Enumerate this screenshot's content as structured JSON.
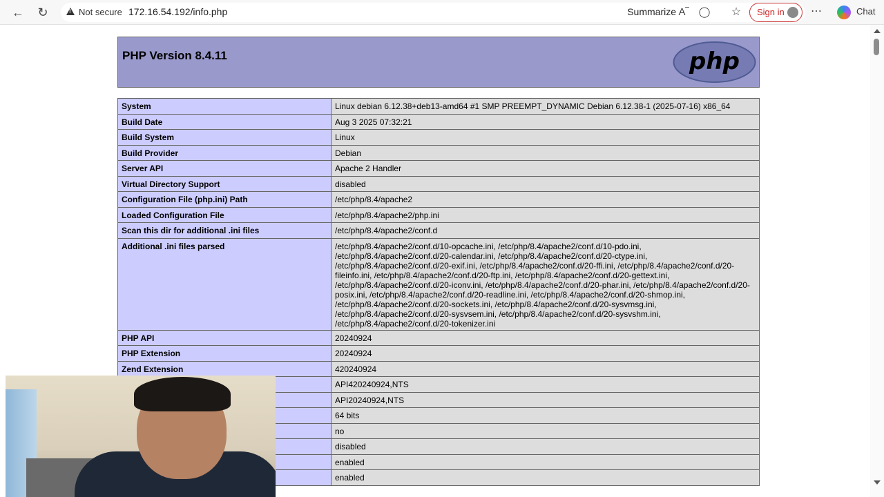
{
  "browser": {
    "not_secure": "Not secure",
    "url": "172.16.54.192/info.php",
    "summarize": "Summarize",
    "sign_in": "Sign in",
    "chat": "Chat",
    "icons": [
      "back-icon",
      "reload-icon",
      "warning-icon",
      "translate-icon",
      "read-aloud-icon",
      "favorite-star-icon",
      "favorites-icon",
      "avatar-icon",
      "more-icon",
      "copilot-icon"
    ]
  },
  "page": {
    "title": "PHP Version 8.4.11",
    "logo_text": "php",
    "rows": [
      {
        "k": "System",
        "v": "Linux debian 6.12.38+deb13-amd64 #1 SMP PREEMPT_DYNAMIC Debian 6.12.38-1 (2025-07-16) x86_64"
      },
      {
        "k": "Build Date",
        "v": "Aug 3 2025 07:32:21"
      },
      {
        "k": "Build System",
        "v": "Linux"
      },
      {
        "k": "Build Provider",
        "v": "Debian"
      },
      {
        "k": "Server API",
        "v": "Apache 2 Handler"
      },
      {
        "k": "Virtual Directory Support",
        "v": "disabled"
      },
      {
        "k": "Configuration File (php.ini) Path",
        "v": "/etc/php/8.4/apache2"
      },
      {
        "k": "Loaded Configuration File",
        "v": "/etc/php/8.4/apache2/php.ini"
      },
      {
        "k": "Scan this dir for additional .ini files",
        "v": "/etc/php/8.4/apache2/conf.d"
      },
      {
        "k": "Additional .ini files parsed",
        "lines": [
          "/etc/php/8.4/apache2/conf.d/10-opcache.ini, /etc/php/8.4/apache2/conf.d/10-pdo.ini,",
          "/etc/php/8.4/apache2/conf.d/20-calendar.ini, /etc/php/8.4/apache2/conf.d/20-ctype.ini,",
          "/etc/php/8.4/apache2/conf.d/20-exif.ini, /etc/php/8.4/apache2/conf.d/20-ffi.ini, /etc/php/8.4/apache2/conf.d/20-",
          "fileinfo.ini, /etc/php/8.4/apache2/conf.d/20-ftp.ini, /etc/php/8.4/apache2/conf.d/20-gettext.ini,",
          "/etc/php/8.4/apache2/conf.d/20-iconv.ini, /etc/php/8.4/apache2/conf.d/20-phar.ini, /etc/php/8.4/apache2/conf.d/20-",
          "posix.ini, /etc/php/8.4/apache2/conf.d/20-readline.ini, /etc/php/8.4/apache2/conf.d/20-shmop.ini,",
          "/etc/php/8.4/apache2/conf.d/20-sockets.ini, /etc/php/8.4/apache2/conf.d/20-sysvmsg.ini,",
          "/etc/php/8.4/apache2/conf.d/20-sysvsem.ini, /etc/php/8.4/apache2/conf.d/20-sysvshm.ini,",
          "/etc/php/8.4/apache2/conf.d/20-tokenizer.ini"
        ]
      },
      {
        "k": "PHP API",
        "v": "20240924"
      },
      {
        "k": "PHP Extension",
        "v": "20240924"
      },
      {
        "k": "Zend Extension",
        "v": "420240924"
      },
      {
        "k": "",
        "v": "API420240924,NTS"
      },
      {
        "k": "",
        "v": "API20240924,NTS"
      },
      {
        "k": "",
        "v": "64 bits"
      },
      {
        "k": "",
        "v": "no"
      },
      {
        "k": "",
        "v": "disabled"
      },
      {
        "k": "",
        "v": "enabled"
      },
      {
        "k": "",
        "v": "enabled"
      }
    ]
  }
}
